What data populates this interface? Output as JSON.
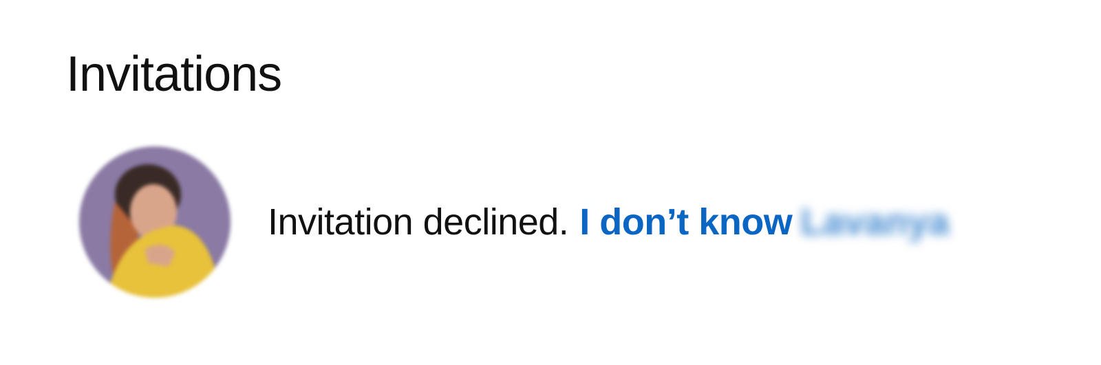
{
  "section": {
    "title": "Invitations"
  },
  "invitation": {
    "avatar_icon": "profile-photo",
    "status_text": "Invitation declined.",
    "link_text": "I don’t know",
    "person_name": "Lavanya"
  },
  "colors": {
    "link": "#0a66c2",
    "text": "#111111",
    "avatar_background": "#8a7aa4",
    "avatar_clothing": "#e8c23a"
  }
}
